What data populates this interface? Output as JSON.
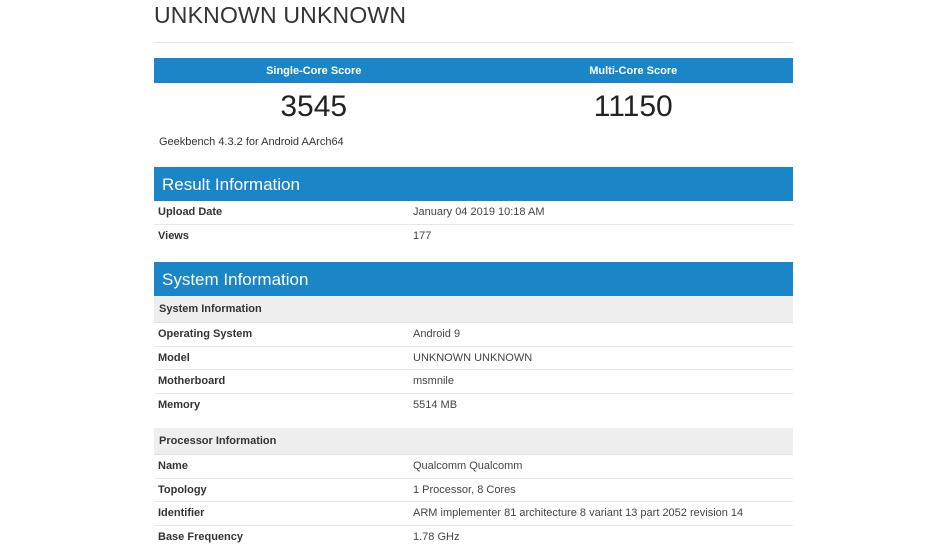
{
  "device_title": "UNKNOWN UNKNOWN",
  "scores": {
    "single_label": "Single-Core Score",
    "multi_label": "Multi-Core Score",
    "single_value": "3545",
    "multi_value": "11150"
  },
  "bench_version": "Geekbench 4.3.2 for Android AArch64",
  "result_info": {
    "title": "Result Information",
    "rows": [
      {
        "key": "Upload Date",
        "value": "January 04 2019 10:18 AM"
      },
      {
        "key": "Views",
        "value": "177"
      }
    ]
  },
  "system_info": {
    "title": "System Information",
    "system_sub": {
      "title": "System Information",
      "rows": [
        {
          "key": "Operating System",
          "value": "Android 9"
        },
        {
          "key": "Model",
          "value": "UNKNOWN UNKNOWN"
        },
        {
          "key": "Motherboard",
          "value": "msmnile"
        },
        {
          "key": "Memory",
          "value": "5514 MB"
        }
      ]
    },
    "processor_sub": {
      "title": "Processor Information",
      "rows": [
        {
          "key": "Name",
          "value": "Qualcomm Qualcomm"
        },
        {
          "key": "Topology",
          "value": "1 Processor, 8 Cores"
        },
        {
          "key": "Identifier",
          "value": "ARM implementer 81 architecture 8 variant 13 part 2052 revision 14"
        },
        {
          "key": "Base Frequency",
          "value": "1.78 GHz"
        }
      ]
    }
  },
  "colors": {
    "accent": "#1a86c8",
    "subhead_bg": "#eeeeee"
  }
}
